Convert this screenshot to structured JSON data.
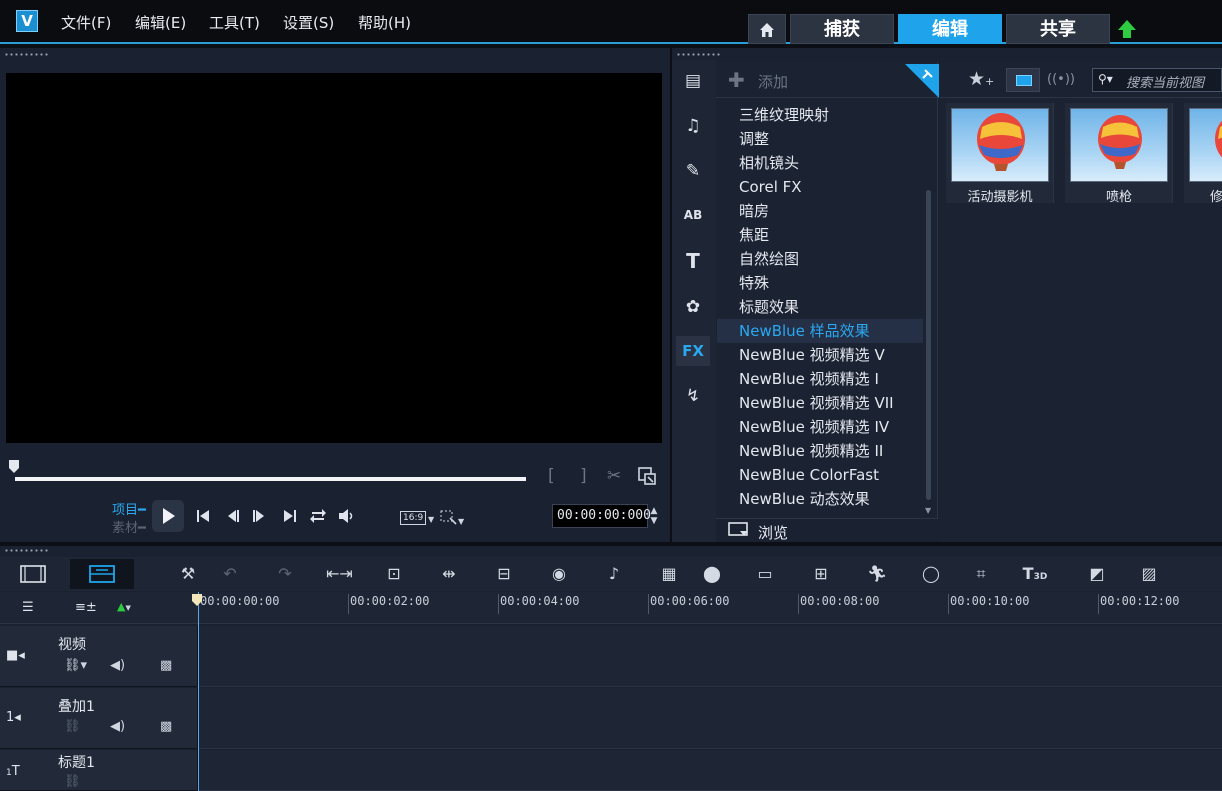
{
  "app": {
    "logo_letter": "V"
  },
  "menu": [
    "文件(F)",
    "编辑(E)",
    "工具(T)",
    "设置(S)",
    "帮助(H)"
  ],
  "nav": {
    "home_icon": "home-icon",
    "tabs": [
      "捕获",
      "编辑",
      "共享"
    ],
    "active_tab": "编辑"
  },
  "player": {
    "mode_project": "项目",
    "mode_clip": "素材",
    "aspect": "16:9",
    "timecode": "00:00:00:000"
  },
  "library": {
    "add_label": "添加",
    "browse_label": "浏览",
    "search_placeholder": "搜索当前视图",
    "fx_items": [
      "三维纹理映射",
      "调整",
      "相机镜头",
      "Corel FX",
      "暗房",
      "焦距",
      "自然绘图",
      "特殊",
      "标题效果",
      "NewBlue 样品效果",
      "NewBlue 视频精选 V",
      "NewBlue 视频精选 I",
      "NewBlue 视频精选 VII",
      "NewBlue 视频精选 IV",
      "NewBlue 视频精选 II",
      "NewBlue ColorFast",
      "NewBlue 动态效果"
    ],
    "selected_fx": "NewBlue 样品效果",
    "side_icons": [
      "media-icon",
      "audio-icon",
      "instant-project-icon",
      "transition-icon",
      "title-icon",
      "graphic-icon",
      "fx-icon",
      "path-icon"
    ],
    "fx_tab_label": "FX",
    "thumbnails": [
      "活动摄影机",
      "喷枪",
      "修"
    ]
  },
  "timeline": {
    "ticks": [
      "00:00:00:00",
      "00:00:02:00",
      "00:00:04:00",
      "00:00:06:00",
      "00:00:08:00",
      "00:00:10:00",
      "00:00:12:00"
    ],
    "tracks": [
      {
        "name": "视频",
        "badge": ""
      },
      {
        "name": "叠加1",
        "badge": "1"
      },
      {
        "name": "标题1",
        "badge": "1"
      }
    ]
  },
  "colors": {
    "accent": "#1fa4ec",
    "active_tab": "#1fa4ec",
    "upload_arrow": "#2ecc40"
  }
}
